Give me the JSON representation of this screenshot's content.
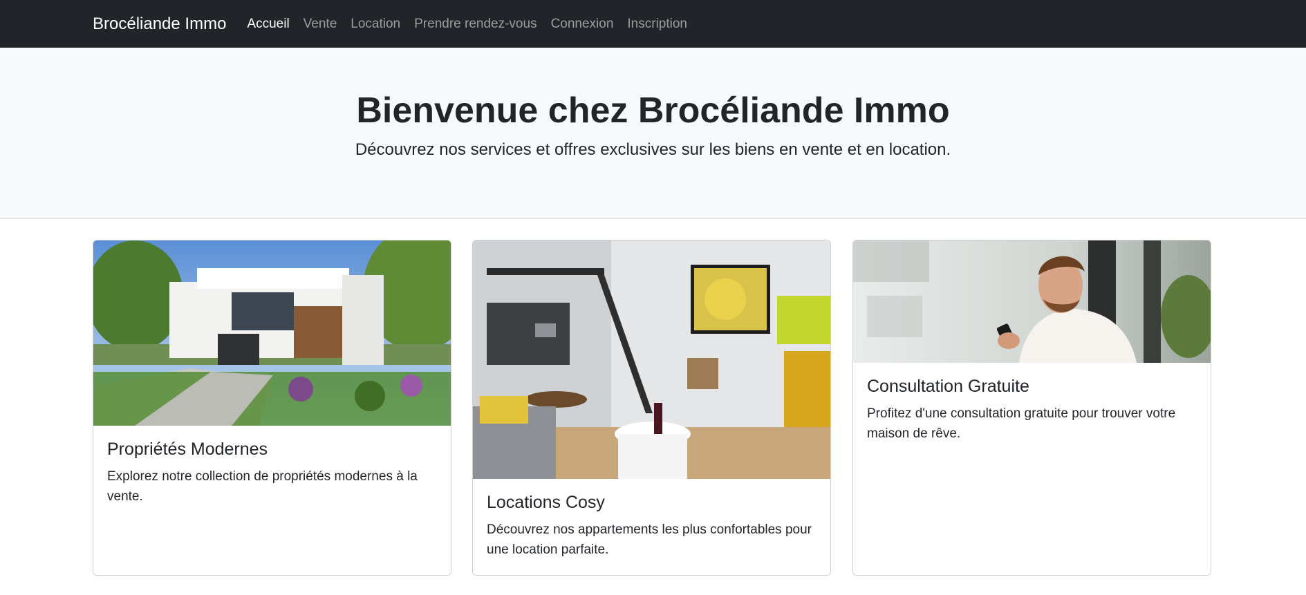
{
  "navbar": {
    "brand": "Brocéliande Immo",
    "links": [
      "Accueil",
      "Vente",
      "Location",
      "Prendre rendez-vous",
      "Connexion",
      "Inscription"
    ],
    "active_index": 0
  },
  "hero": {
    "title": "Bienvenue chez Brocéliande Immo",
    "subtitle": "Découvrez nos services et offres exclusives sur les biens en vente et en location."
  },
  "cards": [
    {
      "title": "Propriétés Modernes",
      "text": "Explorez notre collection de propriétés modernes à la vente."
    },
    {
      "title": "Locations Cosy",
      "text": "Découvrez nos appartements les plus confortables pour une location parfaite."
    },
    {
      "title": "Consultation Gratuite",
      "text": "Profitez d'une consultation gratuite pour trouver votre maison de rêve."
    }
  ],
  "colors": {
    "navbar_bg": "#212529",
    "hero_bg": "#f8f9fa",
    "text": "#212529"
  }
}
